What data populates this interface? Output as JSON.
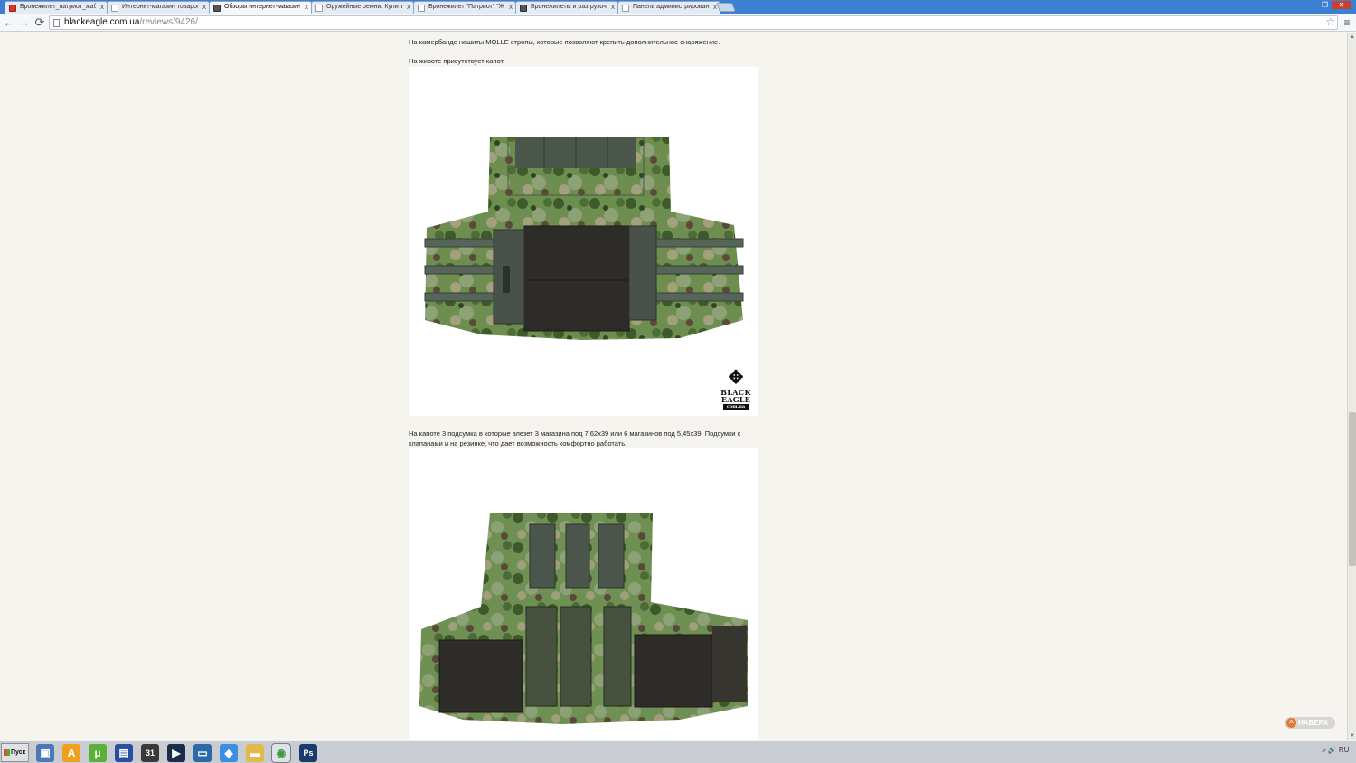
{
  "browser": {
    "tabs": [
      {
        "title": "Бронежилет_патриот_жаб",
        "icon": "yandex-icon",
        "active": false
      },
      {
        "title": "Интернет-магазин товаров",
        "icon": "page-icon",
        "active": false
      },
      {
        "title": "Обзоры интернет-магазин",
        "icon": "eagle-icon",
        "active": true
      },
      {
        "title": "Оружейные ремни. Купить",
        "icon": "page-icon",
        "active": false
      },
      {
        "title": "Бронежилет \"Патриот\" \"Ж",
        "icon": "page-icon",
        "active": false
      },
      {
        "title": "Бронежилеты и разгрузочн",
        "icon": "eagle-icon",
        "active": false
      },
      {
        "title": "Панель администрирования",
        "icon": "page-icon",
        "active": false
      }
    ],
    "close_glyph": "x",
    "window_controls": {
      "minimize": "–",
      "restore": "❐",
      "close": "✕"
    },
    "nav": {
      "back": "←",
      "forward": "→",
      "reload": "⟳"
    },
    "url": {
      "host": "blackeagle.com.ua",
      "path": "/reviews/9426/"
    },
    "star_glyph": "☆",
    "menu_glyph": "≡"
  },
  "article": {
    "paragraphs": [
      "На камербанде нашиты MOLLE стропы, которые позволяют крепить дополнительное снаряжение.",
      "На животе присутствует капот.",
      "На капоте 3 подсумка в которые влезет 3 магазина под 7,62х39 или 6 магазинов под 5,45х39. Подсумки с клапанами и на резинке, что  дает возможность комфортно работать."
    ],
    "logo": {
      "line1": "BLACK",
      "line2": "EAGLE",
      "line3": "com.ua"
    }
  },
  "back_to_top": {
    "label": "НАВЕРХ",
    "glyph": "^"
  },
  "scrollbar": {
    "up": "▲",
    "down": "▼"
  },
  "taskbar": {
    "start_label": "Пуск",
    "apps": [
      {
        "name": "computer-icon",
        "glyph": "▣",
        "color": "#4a79b8"
      },
      {
        "name": "avast-icon",
        "glyph": "A",
        "color": "#f0a020"
      },
      {
        "name": "utorrent-icon",
        "glyph": "µ",
        "color": "#5bb03a"
      },
      {
        "name": "save-disk-icon",
        "glyph": "▤",
        "color": "#2a4fa0"
      },
      {
        "name": "calendar-icon",
        "glyph": "31",
        "color": "#3a3a3a"
      },
      {
        "name": "media-player-icon",
        "glyph": "▶",
        "color": "#1b2b4a"
      },
      {
        "name": "monitor-icon",
        "glyph": "▭",
        "color": "#2a6aa8"
      },
      {
        "name": "dropbox-icon",
        "glyph": "◆",
        "color": "#3d8fe0"
      },
      {
        "name": "folder-icon",
        "glyph": "▬",
        "color": "#e2b94a"
      },
      {
        "name": "chrome-icon",
        "glyph": "◉",
        "color": "#3d9a3a"
      },
      {
        "name": "photoshop-icon",
        "glyph": "Ps",
        "color": "#1d3a6e"
      }
    ],
    "tray": {
      "arrow": "»",
      "sound": "🔊",
      "lang": "RU"
    }
  }
}
